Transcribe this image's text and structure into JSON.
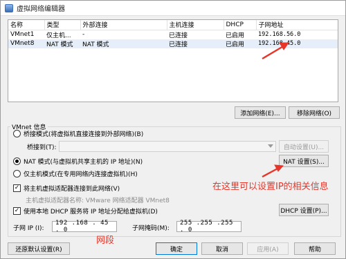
{
  "window": {
    "title": "虚拟网络编辑器"
  },
  "table": {
    "headers": [
      "名称",
      "类型",
      "外部连接",
      "主机连接",
      "DHCP",
      "子网地址"
    ],
    "rows": [
      [
        "VMnet1",
        "仅主机...",
        "-",
        "已连接",
        "已启用",
        "192.168.56.0"
      ],
      [
        "VMnet8",
        "NAT 模式",
        "NAT 模式",
        "已连接",
        "已启用",
        "192.168.45.0"
      ]
    ]
  },
  "buttons": {
    "add_network": "添加网络(E)...",
    "remove_network": "移除网络(O)",
    "auto_settings": "自动设置(U)...",
    "nat_settings": "NAT 设置(S)...",
    "dhcp_settings": "DHCP 设置(P)...",
    "restore_defaults": "还原默认设置(R)",
    "ok": "确定",
    "cancel": "取消",
    "apply": "应用(A)",
    "help": "帮助"
  },
  "vmnet_info": {
    "group_label": "VMnet 信息",
    "bridged_label": "桥接模式(将虚拟机直接连接到外部网络)(B)",
    "bridged_to_label": "桥接到(T):",
    "bridged_to_value": "",
    "nat_label": "NAT 模式(与虚拟机共享主机的 IP 地址)(N)",
    "hostonly_label": "仅主机模式(在专用网络内连接虚拟机)(H)",
    "connect_adapter_label": "将主机虚拟适配器连接到此网络(V)",
    "adapter_name_label": "主机虚拟适配器名称: VMware 网络适配器 VMnet8",
    "use_dhcp_label": "使用本地 DHCP 服务将 IP 地址分配给虚拟机(D)",
    "subnet_ip_label": "子网 IP (I):",
    "subnet_ip_value": "192 .168 . 45  . 0",
    "subnet_mask_label": "子网掩码(M):",
    "subnet_mask_value": "255 .255 .255 . 0"
  },
  "annotations": {
    "nat_note": "在这里可以设置IP的相关信息",
    "segment_note": "网段",
    "color": "#e8352a"
  }
}
